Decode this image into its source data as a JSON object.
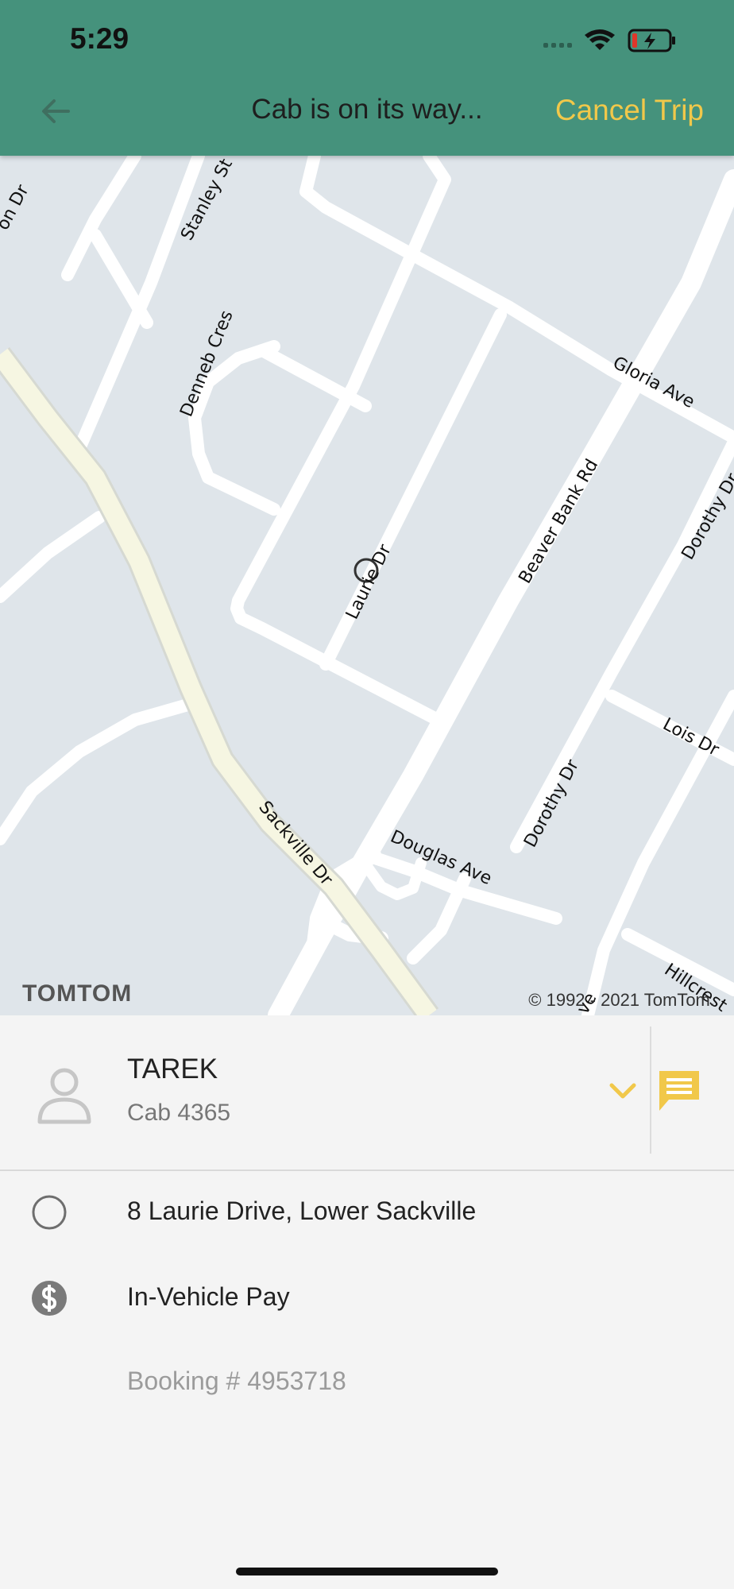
{
  "status_bar": {
    "time": "5:29",
    "signal_icon": "signal-dots-icon",
    "wifi_icon": "wifi-icon",
    "battery_icon": "battery-charging-icon"
  },
  "header": {
    "back_icon": "arrow-left-icon",
    "title": "Cab is on its way...",
    "cancel_label": "Cancel Trip",
    "background_color": "#45927c",
    "accent_color": "#f1c84a"
  },
  "map": {
    "provider_logo": "TOMTOM",
    "copyright": "© 1992 - 2021 TomTom.",
    "pickup_marker_icon": "circle-marker-icon",
    "street_labels": {
      "stanley": "Stanley St",
      "on_dr": "on Dr",
      "denneb": "Denneb Cres",
      "gloria": "Gloria Ave",
      "beaver": "Beaver Bank Rd",
      "dorothy_top": "Dorothy Dr",
      "laurie": "Laurie Dr",
      "lois": "Lois Dr",
      "dorothy_bottom": "Dorothy Dr",
      "douglas": "Douglas Ave",
      "sackville": "Sackville Dr",
      "hillcrest": "Hillcrest",
      "ave_fragment": "ve"
    }
  },
  "driver": {
    "avatar_icon": "person-icon",
    "name": "TAREK",
    "cab": "Cab 4365",
    "expand_icon": "chevron-down-icon",
    "chat_icon": "chat-bubble-icon"
  },
  "trip": {
    "address_icon": "circle-outline-icon",
    "address": "8 Laurie Drive, Lower Sackville",
    "payment_icon": "dollar-circle-icon",
    "payment": "In-Vehicle Pay",
    "booking": "Booking # 4953718"
  }
}
